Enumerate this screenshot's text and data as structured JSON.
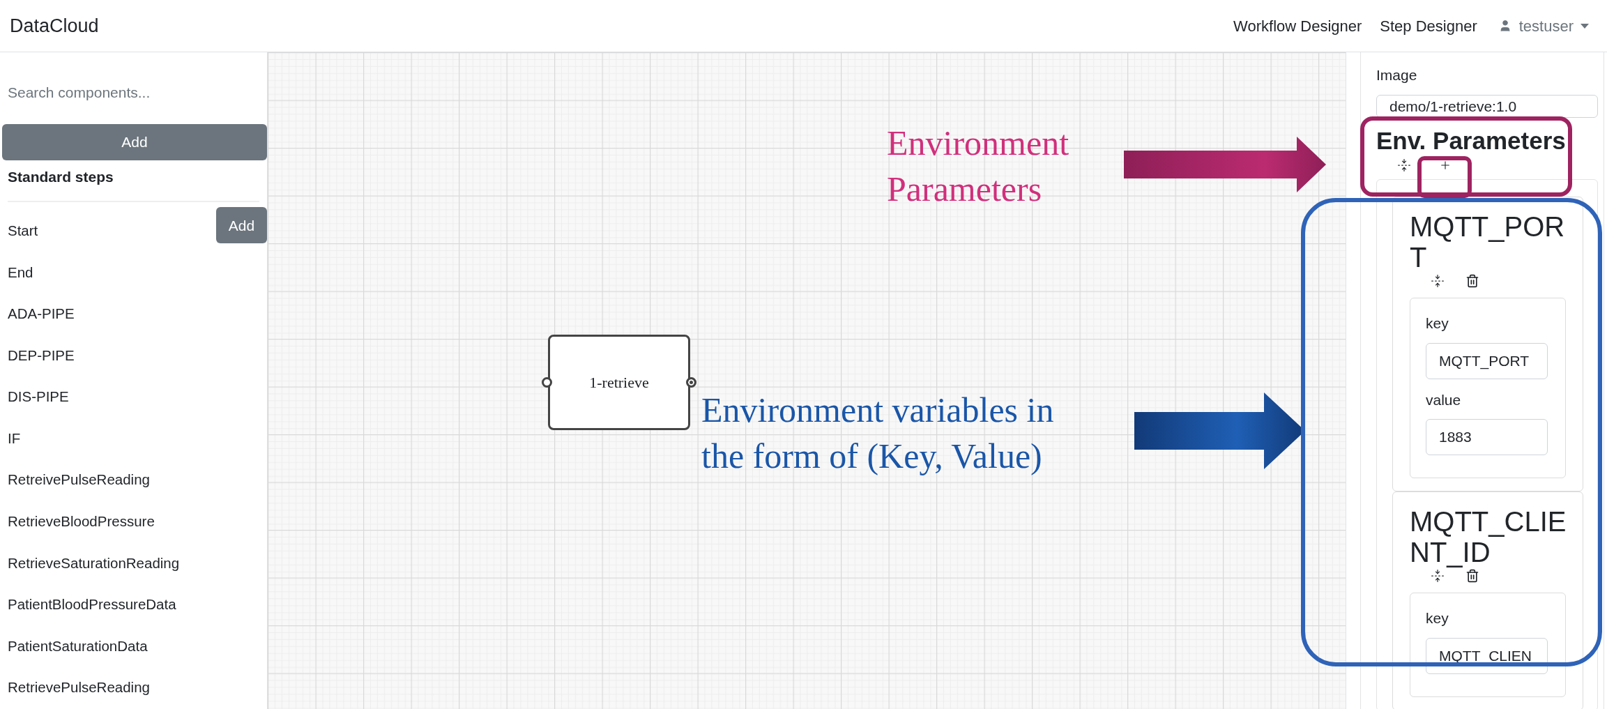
{
  "navbar": {
    "brand": "DataCloud",
    "links": [
      {
        "label": "Workflow Designer"
      },
      {
        "label": "Step Designer"
      }
    ],
    "user": {
      "label": "testuser"
    }
  },
  "sidebar": {
    "search": {
      "placeholder": "Search components..."
    },
    "add_button": "Add",
    "section_title": "Standard steps",
    "items": [
      {
        "label": "Start",
        "add_button": "Add"
      },
      {
        "label": "End"
      },
      {
        "label": "ADA-PIPE"
      },
      {
        "label": "DEP-PIPE"
      },
      {
        "label": "DIS-PIPE"
      },
      {
        "label": "IF"
      },
      {
        "label": "RetreivePulseReading"
      },
      {
        "label": "RetrieveBloodPressure"
      },
      {
        "label": "RetrieveSaturationReading"
      },
      {
        "label": "PatientBloodPressureData"
      },
      {
        "label": "PatientSaturationData"
      },
      {
        "label": "RetrievePulseReading"
      }
    ]
  },
  "canvas": {
    "nodes": [
      {
        "label": "1-retrieve"
      }
    ]
  },
  "annotations": [
    {
      "text": "Environment Parameters",
      "color": "#d12f7c"
    },
    {
      "text": "Environment variables in the form of (Key, Value)",
      "color": "#1a56a8"
    }
  ],
  "properties": {
    "image": {
      "label": "Image",
      "value": "demo/1-retrieve:1.0"
    },
    "env_title": "Env. Parameters",
    "env_vars": [
      {
        "name": "MQTT_PORT",
        "fields": [
          {
            "label": "key",
            "value": "MQTT_PORT"
          },
          {
            "label": "value",
            "value": "1883"
          }
        ]
      },
      {
        "name": "MQTT_CLIENT_ID",
        "fields": [
          {
            "label": "key",
            "value": "MQTT_CLIEN"
          }
        ]
      }
    ]
  }
}
